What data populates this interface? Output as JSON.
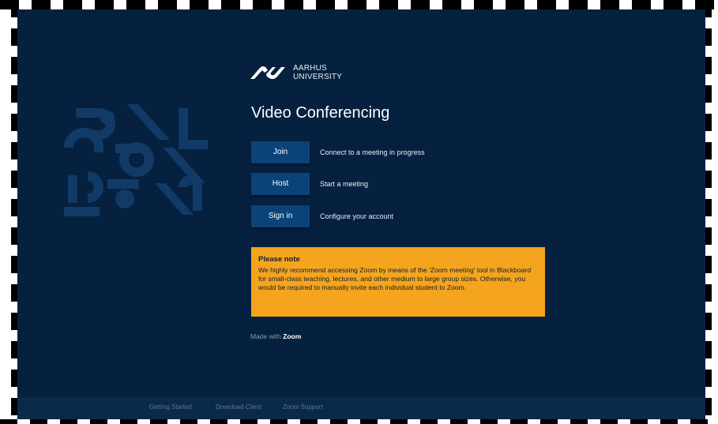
{
  "logo": {
    "line1": "AARHUS",
    "line2": "UNIVERSITY"
  },
  "page_title": "Video Conferencing",
  "actions": [
    {
      "label": "Join",
      "description": "Connect to a meeting in progress"
    },
    {
      "label": "Host",
      "description": "Start a meeting"
    },
    {
      "label": "Sign in",
      "description": "Configure your account"
    }
  ],
  "note": {
    "title": "Please note",
    "body": "We highly recommend accessing Zoom by means of the 'Zoom meeting' tool in Blackboard for small-class teaching, lectures, and other medium to large group sizes. Otherwise, you would be required to manually invite each individual student to Zoom."
  },
  "made_with": {
    "prefix": "Made with",
    "brand": "Zoom"
  },
  "footer": {
    "links": [
      "Getting Started",
      "Download Client",
      "Zoom Support"
    ]
  },
  "colors": {
    "background": "#05213f",
    "button": "#0a4378",
    "note": "#f5a41d",
    "footer": "#0b2a4a"
  }
}
